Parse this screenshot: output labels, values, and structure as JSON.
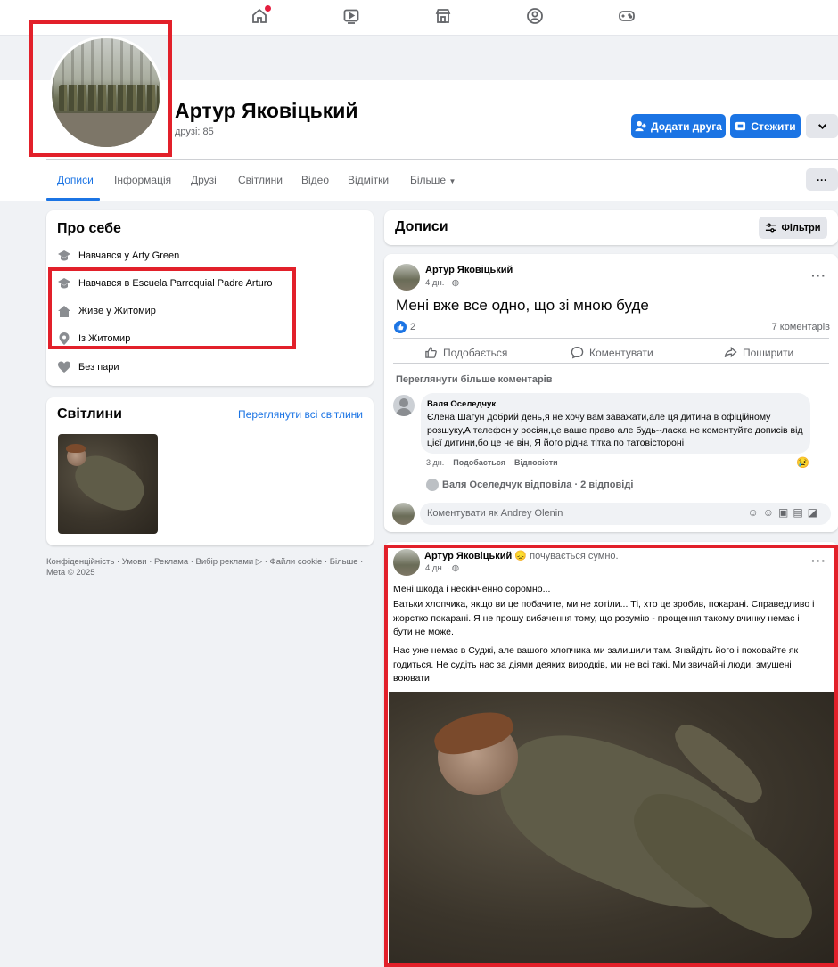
{
  "nav": {
    "icons": [
      "home-icon",
      "video-icon",
      "marketplace-icon",
      "groups-icon",
      "gaming-icon"
    ]
  },
  "profile": {
    "name": "Артур Яковіцький",
    "friends": "друзі: 85",
    "add_friend": "Додати друга",
    "follow": "Стежити"
  },
  "tabs": [
    "Дописи",
    "Інформація",
    "Друзі",
    "Світлини",
    "Відео",
    "Відмітки",
    "Більше"
  ],
  "about": {
    "title": "Про себе",
    "items": [
      {
        "icon": "education-icon",
        "text": "Навчався у Arty Green"
      },
      {
        "icon": "education-icon",
        "text": "Навчався в Escuela Parroquial Padre Arturo"
      },
      {
        "icon": "home-icon",
        "text": "Живе у Житомир"
      },
      {
        "icon": "location-icon",
        "text": "Із Житомир"
      },
      {
        "icon": "heart-icon",
        "text": "Без пари"
      }
    ]
  },
  "photos": {
    "title": "Світлини",
    "see_all": "Переглянути всі світлини"
  },
  "footer": {
    "links": "Конфіденційність · Умови · Реклама · Вибір реклами ▷ · Файли cookie · Більше ·",
    "copyright": "Meta © 2025"
  },
  "posts_header": {
    "title": "Дописи",
    "filters": "Фільтри"
  },
  "post1": {
    "author": "Артур Яковіцький",
    "time": "4 дн. ·",
    "text": "Мені вже все одно, що зі мною буде",
    "likes": "2",
    "comments_count": "7 коментарів",
    "like": "Подобається",
    "comment": "Коментувати",
    "share": "Поширити",
    "more_comments": "Переглянути більше коментарів",
    "comment_author": "Валя Оселедчук",
    "comment_text": "Єлена Шагун добрий день,я не хочу вам заважати,але ця дитина в офіційному розшуку,А телефон у росіян,це ваше право але будь--ласка не коментуйте дописів від цієї дитини,бо це не він, Я його рідна тітка по татовісторoні",
    "comment_time": "3 дн.",
    "comment_like": "Подобається",
    "comment_reply": "Відповісти",
    "reply_summary": "Валя Оселедчук відповіла · 2 відповіді",
    "composer_placeholder": "Коментувати як Andrey Olenin"
  },
  "post2": {
    "author": "Артур Яковіцький",
    "feeling": "😞 почувається сумно.",
    "time": "4 дн. ·",
    "p1": "Мені шкода і нескінченно соромно...",
    "p2": "Батьки хлопчика, якщо ви це побачите, ми не хотіли... Ті, хто це зробив, покарані. Справедливо і жорстко покарані. Я не прошу вибачення тому, що розумію - прощення такому вчинку немає і бути не може.",
    "p3": "Нас уже немає в Суджі, але вашого хлопчика ми залишили там. Знайдіть його і поховайте як годиться. Не судіть нас за діями деяких виродків, ми не всі такі. Ми звичайні люди, змушені воювати"
  },
  "colors": {
    "accent": "#1b74e4",
    "highlight": "#e2202a"
  }
}
